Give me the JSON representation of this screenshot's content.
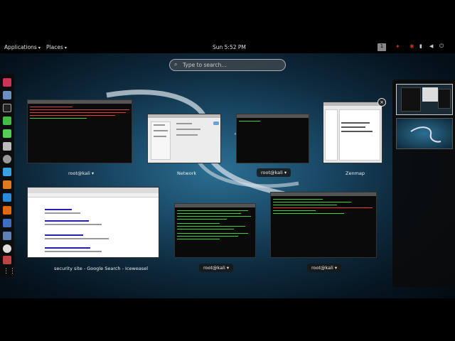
{
  "topbar": {
    "applications": "Applications",
    "places": "Places",
    "clock": "Sun  5:52 PM",
    "workspace_indicator": "1"
  },
  "search": {
    "placeholder": "Type to search..."
  },
  "windows": [
    {
      "title": "root@kali",
      "menu_arrow": "▾"
    },
    {
      "title": "Network"
    },
    {
      "title": "root@kali",
      "menu_arrow": "▾"
    },
    {
      "title": "Zenmap"
    },
    {
      "title": "security site - Google Search - Iceweasel"
    },
    {
      "title": "root@kali",
      "menu_arrow": "▾"
    },
    {
      "title": "root@kali",
      "menu_arrow": "▾"
    }
  ],
  "dash_icons": [
    "iceweasel-icon",
    "folder-icon",
    "terminal-icon",
    "green-app-icon",
    "green-app-icon",
    "tools-icon",
    "gear-icon",
    "blue-app-icon",
    "orange-app-icon",
    "blue-app-icon",
    "orange-app-icon",
    "metasploit-icon",
    "folder-icon",
    "armitage-icon",
    "settings-icon",
    "grid-apps-icon"
  ],
  "colors": {
    "accent": "#2c6f93",
    "terminal_green": "#3fcf3f",
    "terminal_red": "#e04040"
  }
}
